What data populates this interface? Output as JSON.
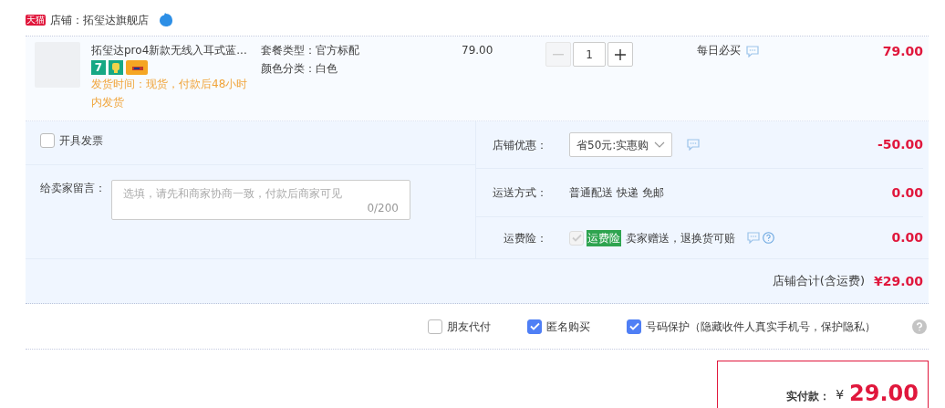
{
  "shop": {
    "badge": "天猫",
    "label": "店铺：拓玺达旗舰店"
  },
  "item": {
    "title": "拓玺达pro4新款无线入耳式蓝...",
    "specs": [
      "套餐类型：官方标配",
      "颜色分类：白色"
    ],
    "delivery": "发货时间：现货，付款后48小时内发货",
    "badge_number": "7",
    "price": "79.00",
    "quantity": "1",
    "minus_disabled": true,
    "promo": "每日必买",
    "subtotal": "79.00"
  },
  "invoice": {
    "label": "开具发票",
    "checked": false
  },
  "message": {
    "label": "给卖家留言：",
    "placeholder": "选填，请先和商家协商一致，付款后商家可见",
    "counter": "0/200"
  },
  "discount": {
    "label": "店铺优惠：",
    "value": "省50元:实惠购",
    "amount": "-50.00"
  },
  "shipping": {
    "label": "运送方式：",
    "value": "普通配送 快递 免邮",
    "amount": "0.00"
  },
  "insurance": {
    "label": "运费险：",
    "checked": true,
    "disabled": true,
    "tag": "运费险",
    "text": "卖家赠送，退换货可赔",
    "amount": "0.00"
  },
  "shop_total": {
    "label": "店铺合计(含运费)",
    "amount": "¥29.00"
  },
  "options": [
    {
      "label": "朋友代付",
      "checked": false
    },
    {
      "label": "匿名购买",
      "checked": true
    },
    {
      "label": "号码保护（隐藏收件人真实手机号，保护隐私）",
      "checked": true
    }
  ],
  "payment": {
    "label": "实付款：",
    "currency": "¥",
    "amount": "29.00"
  }
}
